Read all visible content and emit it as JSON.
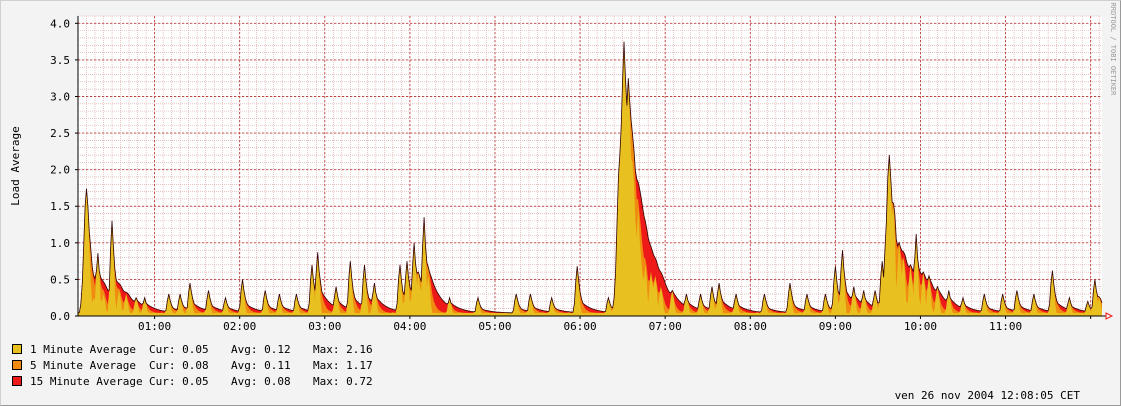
{
  "chart_data": {
    "type": "area",
    "ylabel": "Load Average",
    "ylim": [
      0,
      4.1
    ],
    "ytick_labels": [
      "0.0",
      "0.5",
      "1.0",
      "1.5",
      "2.0",
      "2.5",
      "3.0",
      "3.5",
      "4.0"
    ],
    "xtick_labels": [
      "01:00",
      "02:00",
      "03:00",
      "04:00",
      "05:00",
      "06:00",
      "07:00",
      "08:00",
      "09:00",
      "10:00",
      "11:00"
    ],
    "x_start": "00:06",
    "x_end": "12:08",
    "grid": true,
    "watermark": "RRDTOOL / TOBI OETIKER",
    "timestamp": "ven 26 nov 2004 12:08:05 CET",
    "peaks": [
      {
        "t": "00:09",
        "load_1min": 0.2
      },
      {
        "t": "00:11",
        "load_1min": 0.75
      },
      {
        "t": "00:12",
        "load_1min": 1.74
      },
      {
        "t": "00:14",
        "load_1min": 0.45
      },
      {
        "t": "00:17",
        "load_1min": 0.25
      },
      {
        "t": "00:20",
        "load_1min": 0.86
      },
      {
        "t": "00:24",
        "load_1min": 0.3
      },
      {
        "t": "00:30",
        "load_1min": 1.3
      },
      {
        "t": "00:35",
        "load_1min": 0.35
      },
      {
        "t": "00:40",
        "load_1min": 0.3
      },
      {
        "t": "00:47",
        "load_1min": 0.25
      },
      {
        "t": "00:53",
        "load_1min": 0.25
      },
      {
        "t": "01:10",
        "load_1min": 0.3
      },
      {
        "t": "01:18",
        "load_1min": 0.3
      },
      {
        "t": "01:25",
        "load_1min": 0.45
      },
      {
        "t": "01:38",
        "load_1min": 0.35
      },
      {
        "t": "01:50",
        "load_1min": 0.25
      },
      {
        "t": "02:02",
        "load_1min": 0.5
      },
      {
        "t": "02:18",
        "load_1min": 0.35
      },
      {
        "t": "02:28",
        "load_1min": 0.3
      },
      {
        "t": "02:40",
        "load_1min": 0.3
      },
      {
        "t": "02:51",
        "load_1min": 0.7
      },
      {
        "t": "02:55",
        "load_1min": 0.87
      },
      {
        "t": "03:08",
        "load_1min": 0.4
      },
      {
        "t": "03:18",
        "load_1min": 0.75
      },
      {
        "t": "03:28",
        "load_1min": 0.7
      },
      {
        "t": "03:35",
        "load_1min": 0.45
      },
      {
        "t": "03:53",
        "load_1min": 0.7
      },
      {
        "t": "03:58",
        "load_1min": 0.75
      },
      {
        "t": "04:03",
        "load_1min": 1.0
      },
      {
        "t": "04:06",
        "load_1min": 0.6
      },
      {
        "t": "04:10",
        "load_1min": 1.35
      },
      {
        "t": "04:13",
        "load_1min": 0.55
      },
      {
        "t": "04:28",
        "load_1min": 0.25
      },
      {
        "t": "04:48",
        "load_1min": 0.25
      },
      {
        "t": "05:15",
        "load_1min": 0.3
      },
      {
        "t": "05:25",
        "load_1min": 0.3
      },
      {
        "t": "05:40",
        "load_1min": 0.25
      },
      {
        "t": "05:58",
        "load_1min": 0.68
      },
      {
        "t": "06:20",
        "load_1min": 0.25
      },
      {
        "t": "06:25",
        "load_1min": 0.35
      },
      {
        "t": "06:28",
        "load_1min": 2.2
      },
      {
        "t": "06:30",
        "load_1min": 3.0
      },
      {
        "t": "06:31",
        "load_1min": 3.75
      },
      {
        "t": "06:32",
        "load_1min": 3.1
      },
      {
        "t": "06:33",
        "load_1min": 2.3
      },
      {
        "t": "06:34",
        "load_1min": 3.25
      },
      {
        "t": "06:35",
        "load_1min": 2.5
      },
      {
        "t": "06:37",
        "load_1min": 2.1
      },
      {
        "t": "06:39",
        "load_1min": 1.3
      },
      {
        "t": "06:41",
        "load_1min": 1.5
      },
      {
        "t": "06:43",
        "load_1min": 0.8
      },
      {
        "t": "06:46",
        "load_1min": 0.7
      },
      {
        "t": "06:50",
        "load_1min": 0.6
      },
      {
        "t": "06:53",
        "load_1min": 0.55
      },
      {
        "t": "06:57",
        "load_1min": 0.4
      },
      {
        "t": "07:05",
        "load_1min": 0.35
      },
      {
        "t": "07:15",
        "load_1min": 0.3
      },
      {
        "t": "07:25",
        "load_1min": 0.3
      },
      {
        "t": "07:33",
        "load_1min": 0.4
      },
      {
        "t": "07:38",
        "load_1min": 0.45
      },
      {
        "t": "07:50",
        "load_1min": 0.3
      },
      {
        "t": "08:10",
        "load_1min": 0.3
      },
      {
        "t": "08:28",
        "load_1min": 0.45
      },
      {
        "t": "08:40",
        "load_1min": 0.3
      },
      {
        "t": "08:53",
        "load_1min": 0.3
      },
      {
        "t": "09:00",
        "load_1min": 0.68
      },
      {
        "t": "09:05",
        "load_1min": 0.9
      },
      {
        "t": "09:13",
        "load_1min": 0.4
      },
      {
        "t": "09:20",
        "load_1min": 0.35
      },
      {
        "t": "09:28",
        "load_1min": 0.35
      },
      {
        "t": "09:33",
        "load_1min": 0.75
      },
      {
        "t": "09:36",
        "load_1min": 1.3
      },
      {
        "t": "09:38",
        "load_1min": 2.2
      },
      {
        "t": "09:39",
        "load_1min": 1.6
      },
      {
        "t": "09:41",
        "load_1min": 1.5
      },
      {
        "t": "09:45",
        "load_1min": 1.0
      },
      {
        "t": "09:48",
        "load_1min": 0.8
      },
      {
        "t": "09:53",
        "load_1min": 0.7
      },
      {
        "t": "09:57",
        "load_1min": 1.12
      },
      {
        "t": "10:02",
        "load_1min": 0.6
      },
      {
        "t": "10:06",
        "load_1min": 0.55
      },
      {
        "t": "10:12",
        "load_1min": 0.4
      },
      {
        "t": "10:20",
        "load_1min": 0.35
      },
      {
        "t": "10:30",
        "load_1min": 0.25
      },
      {
        "t": "10:45",
        "load_1min": 0.3
      },
      {
        "t": "10:58",
        "load_1min": 0.3
      },
      {
        "t": "11:08",
        "load_1min": 0.35
      },
      {
        "t": "11:20",
        "load_1min": 0.3
      },
      {
        "t": "11:33",
        "load_1min": 0.62
      },
      {
        "t": "11:45",
        "load_1min": 0.25
      },
      {
        "t": "11:58",
        "load_1min": 0.2
      },
      {
        "t": "12:03",
        "load_1min": 0.5
      },
      {
        "t": "12:06",
        "load_1min": 0.25
      }
    ],
    "series": [
      {
        "name": "1 Minute Average",
        "color": "#e8c020",
        "cur": "0.05",
        "avg": "0.12",
        "max": "2.16"
      },
      {
        "name": "5 Minute Average",
        "color": "#f08a10",
        "cur": "0.08",
        "avg": "0.11",
        "max": "1.17"
      },
      {
        "name": "15 Minute Average",
        "color": "#ee1a1a",
        "cur": "0.05",
        "avg": "0.08",
        "max": "0.72"
      }
    ],
    "legend_labels": {
      "cur": "Cur:",
      "avg": "Avg:",
      "max": "Max:"
    }
  }
}
